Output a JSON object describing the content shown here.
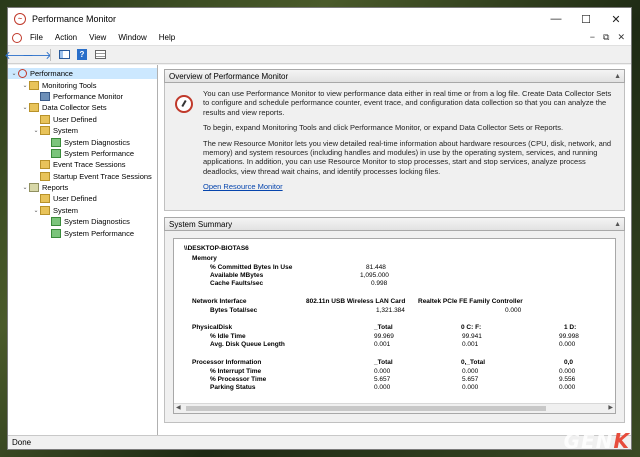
{
  "window": {
    "title": "Performance Monitor"
  },
  "menu": {
    "items": [
      "File",
      "Action",
      "View",
      "Window",
      "Help"
    ],
    "right_icons": [
      "−",
      "⧉",
      "✕"
    ]
  },
  "toolbar": {
    "icons": [
      "back-arrow-icon",
      "forward-arrow-icon",
      "show-hide-tree-icon",
      "help-icon",
      "properties-icon"
    ]
  },
  "tree": {
    "nodes": [
      {
        "label": "Performance",
        "icon": "performance-icon",
        "level": 0,
        "expanded": true
      },
      {
        "label": "Monitoring Tools",
        "icon": "folder-icon",
        "level": 1,
        "expanded": true
      },
      {
        "label": "Performance Monitor",
        "icon": "monitor-icon",
        "level": 2
      },
      {
        "label": "Data Collector Sets",
        "icon": "folder-icon",
        "level": 1,
        "expanded": true
      },
      {
        "label": "User Defined",
        "icon": "folder-icon",
        "level": 2
      },
      {
        "label": "System",
        "icon": "folder-icon",
        "level": 2,
        "expanded": true
      },
      {
        "label": "System Diagnostics",
        "icon": "collector-set-icon",
        "level": 3
      },
      {
        "label": "System Performance",
        "icon": "collector-set-icon",
        "level": 3
      },
      {
        "label": "Event Trace Sessions",
        "icon": "folder-icon",
        "level": 2
      },
      {
        "label": "Startup Event Trace Sessions",
        "icon": "folder-icon",
        "level": 2
      },
      {
        "label": "Reports",
        "icon": "report-icon",
        "level": 1,
        "expanded": true
      },
      {
        "label": "User Defined",
        "icon": "folder-icon",
        "level": 2
      },
      {
        "label": "System",
        "icon": "folder-icon",
        "level": 2,
        "expanded": true
      },
      {
        "label": "System Diagnostics",
        "icon": "collector-set-icon",
        "level": 3
      },
      {
        "label": "System Performance",
        "icon": "collector-set-icon",
        "level": 3
      }
    ]
  },
  "overview": {
    "header": "Overview of Performance Monitor",
    "p1": "You can use Performance Monitor to view performance data either in real time or from a log file. Create Data Collector Sets to configure and schedule performance counter, event trace, and configuration data collection so that you can analyze the results and view reports.",
    "p2": "To begin, expand Monitoring Tools and click Performance Monitor, or expand Data Collector Sets or Reports.",
    "p3": "The new Resource Monitor lets you view detailed real-time information about hardware resources (CPU, disk, network, and memory) and system resources (including handles and modules) in use by the operating system, services, and running applications. In addition, you can use Resource Monitor to stop processes, start and stop services, analyze process deadlocks, view thread wait chains, and identify processes locking files.",
    "link": "Open Resource Monitor"
  },
  "summary": {
    "header": "System Summary",
    "machine": "\\\\DESKTOP-BIOTAS6",
    "memory": {
      "title": "Memory",
      "rows": [
        [
          "% Committed Bytes In Use",
          "81.448"
        ],
        [
          "Available MBytes",
          "1,095.000"
        ],
        [
          "Cache Faults/sec",
          "0.998"
        ]
      ]
    },
    "network": {
      "title": "Network Interface",
      "col1": "802.11n USB Wireless LAN Card",
      "col2": "Realtek PCIe FE Family Controller",
      "row_label": "Bytes Total/sec",
      "v1": "1,321.384",
      "v2": "0.000"
    },
    "disk": {
      "title": "PhysicalDisk",
      "cols": [
        "_Total",
        "0 C: F:",
        "1 D:"
      ],
      "rows": [
        [
          "% Idle Time",
          "99.969",
          "99.941",
          "99.998"
        ],
        [
          "Avg. Disk Queue Length",
          "0.001",
          "0.001",
          "0.000"
        ]
      ]
    },
    "processor": {
      "title": "Processor Information",
      "cols": [
        "_Total",
        "0,_Total",
        "0,0"
      ],
      "rows": [
        [
          "% Interrupt Time",
          "0.000",
          "0.000",
          "0.000"
        ],
        [
          "% Processor Time",
          "5.657",
          "5.657",
          "9.556"
        ],
        [
          "Parking Status",
          "0.000",
          "0.000",
          "0.000"
        ]
      ]
    }
  },
  "status": {
    "text": "Done"
  },
  "watermark": {
    "pre": "GEN",
    "post": "K"
  }
}
